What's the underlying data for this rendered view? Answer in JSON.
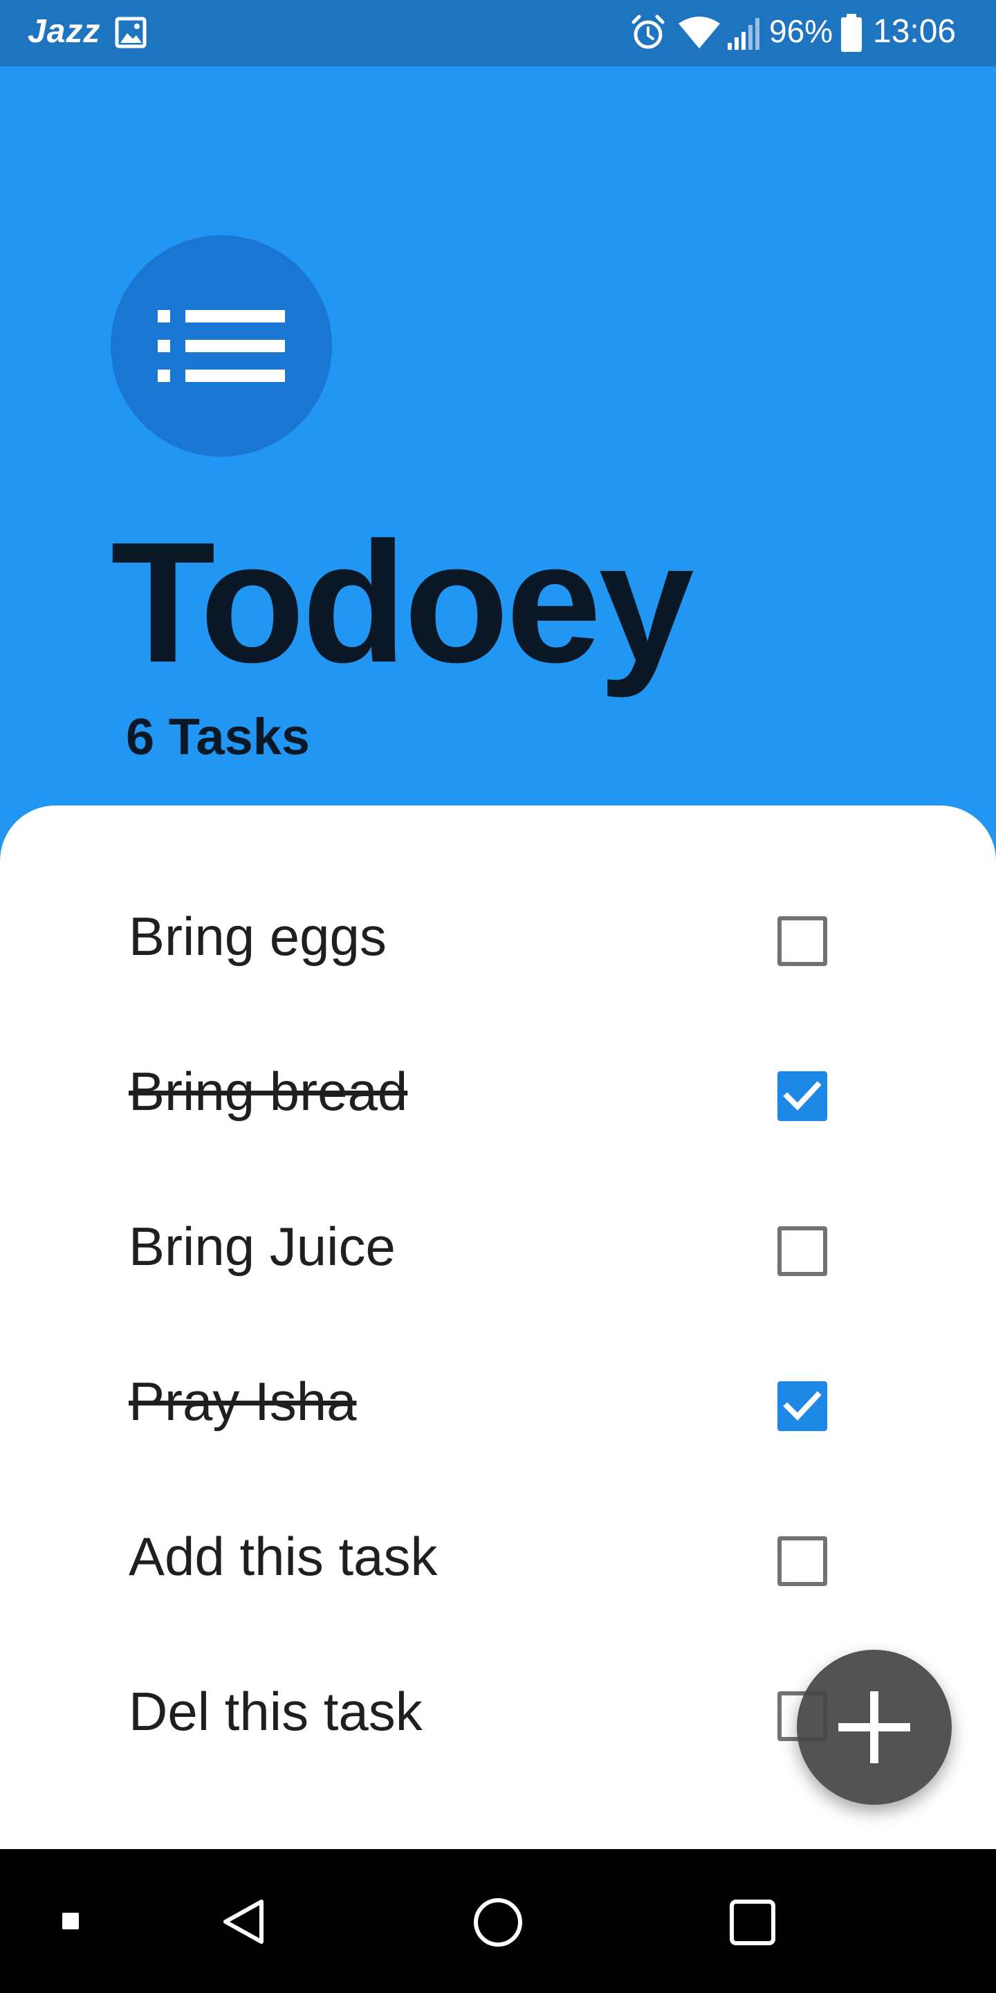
{
  "status_bar": {
    "carrier": "Jazz",
    "battery_percent": "96%",
    "time": "13:06",
    "icons": [
      "gallery-icon",
      "alarm-icon",
      "wifi-icon",
      "signal-icon",
      "battery-icon"
    ]
  },
  "header": {
    "app_icon": "list-icon",
    "title": "Todoey",
    "task_count": "6 Tasks"
  },
  "tasks": [
    {
      "label": "Bring eggs",
      "done": false
    },
    {
      "label": "Bring bread",
      "done": true
    },
    {
      "label": "Bring Juice",
      "done": false
    },
    {
      "label": "Pray Isha",
      "done": true
    },
    {
      "label": "Add this task",
      "done": false
    },
    {
      "label": "Del this task",
      "done": false
    }
  ],
  "fab": {
    "icon": "plus-icon"
  },
  "nav_bar": {
    "buttons": [
      "recents-dot-icon",
      "back-icon",
      "home-icon",
      "overview-icon"
    ]
  },
  "colors": {
    "header_bg": "#2196F3",
    "status_bar_bg": "#1E74BF",
    "icon_circle": "#1976D2",
    "checkbox_checked": "#1E88E5",
    "title_text": "#0A1724",
    "fab_bg": "#464646"
  }
}
